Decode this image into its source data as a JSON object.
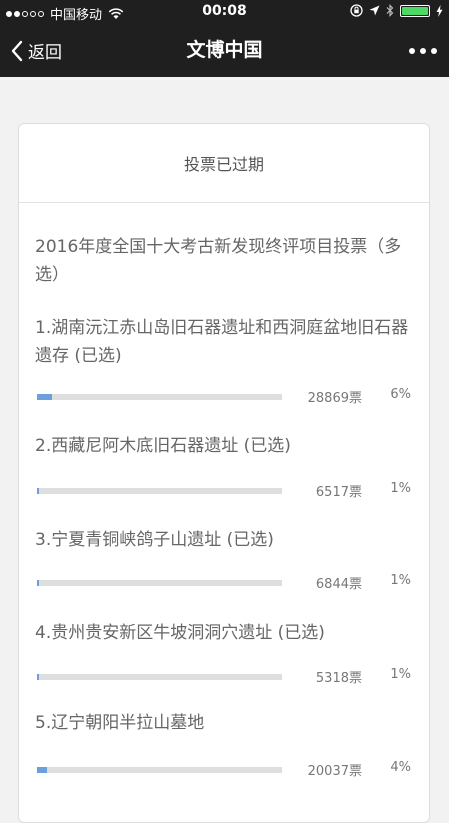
{
  "status": {
    "carrier": "中国移动",
    "time": "00:08"
  },
  "nav": {
    "back_label": "返回",
    "title": "文博中国"
  },
  "card": {
    "header": "投票已过期",
    "question": "2016年度全国十大考古新发现终评项目投票（多选）",
    "options": [
      {
        "label": "1.湖南沅江赤山岛旧石器遗址和西洞庭盆地旧石器遗存 (已选)",
        "count": "28869票",
        "pct": "6%",
        "fraction": 0.06
      },
      {
        "label": "2.西藏尼阿木底旧石器遗址 (已选)",
        "count": "6517票",
        "pct": "1%",
        "fraction": 0.01
      },
      {
        "label": "3.宁夏青铜峡鸽子山遗址 (已选)",
        "count": "6844票",
        "pct": "1%",
        "fraction": 0.01
      },
      {
        "label": "4.贵州贵安新区牛坡洞洞穴遗址 (已选)",
        "count": "5318票",
        "pct": "1%",
        "fraction": 0.01
      },
      {
        "label": "5.辽宁朝阳半拉山墓地",
        "count": "20037票",
        "pct": "4%",
        "fraction": 0.04
      }
    ]
  }
}
